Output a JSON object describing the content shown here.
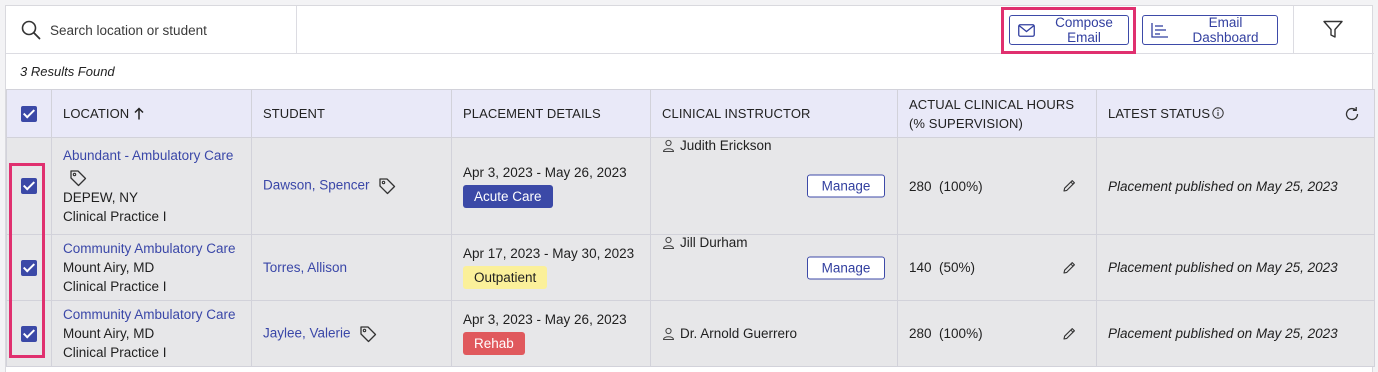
{
  "toolbar": {
    "search_placeholder": "Search location or student",
    "compose_label": "Compose Email",
    "dashboard_label": "Email Dashboard"
  },
  "results_text": "3 Results Found",
  "columns": {
    "location": "LOCATION",
    "student": "STUDENT",
    "placement": "PLACEMENT DETAILS",
    "instructor": "CLINICAL INSTRUCTOR",
    "hours_line1": "ACTUAL CLINICAL HOURS",
    "hours_line2": "(% SUPERVISION)",
    "status": "LATEST STATUS"
  },
  "rows": [
    {
      "checked": true,
      "location_name": "Abundant - Ambulatory Care",
      "location_city": "DEPEW, NY",
      "location_program": "Clinical Practice I",
      "location_has_tag": true,
      "student": "Dawson, Spencer",
      "student_has_tag": true,
      "dates": "Apr 3, 2023 - May 26, 2023",
      "setting": "Acute Care",
      "setting_color": "#3b49a7",
      "instructor": "Judith Erickson",
      "manage_label": "Manage",
      "hours": "280",
      "supervision": "(100%)",
      "status": "Placement published on May 25, 2023"
    },
    {
      "checked": true,
      "location_name": "Community Ambulatory Care",
      "location_city": "Mount Airy, MD",
      "location_program": "Clinical Practice I",
      "location_has_tag": false,
      "student": "Torres, Allison",
      "student_has_tag": false,
      "dates": "Apr 17, 2023 - May 30, 2023",
      "setting": "Outpatient",
      "setting_color": "#fbf09a",
      "instructor": "Jill Durham",
      "manage_label": "Manage",
      "hours": "140",
      "supervision": "(50%)",
      "status": "Placement published on May 25, 2023"
    },
    {
      "checked": true,
      "location_name": "Community Ambulatory Care",
      "location_city": "Mount Airy, MD",
      "location_program": "Clinical Practice I",
      "location_has_tag": false,
      "student": "Jaylee, Valerie",
      "student_has_tag": true,
      "dates": "Apr 3, 2023 - May 26, 2023",
      "setting": "Rehab",
      "setting_color": "#e0595d",
      "instructor": "Dr. Arnold Guerrero",
      "hours": "280",
      "supervision": "(100%)",
      "status": "Placement published on May 25, 2023"
    }
  ],
  "colors": {
    "accent": "#3b49a7",
    "highlight": "#e0306f",
    "header_bg": "#e9e9f8",
    "row_bg": "#e7e7e9"
  }
}
